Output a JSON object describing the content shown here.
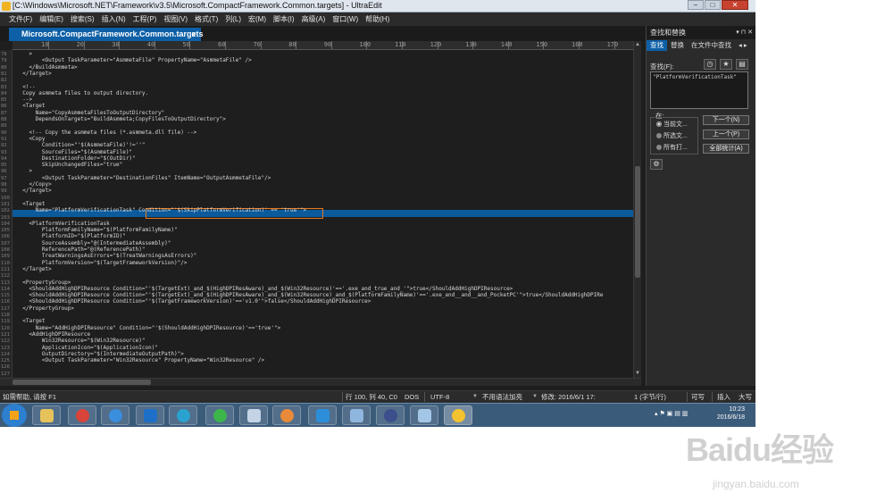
{
  "window": {
    "title": "[C:\\Windows\\Microsoft.NET\\Framework\\v3.5\\Microsoft.CompactFramework.Common.targets] - UltraEdit",
    "min": "–",
    "max": "□",
    "close": "✕"
  },
  "menu": [
    "文件(F)",
    "编辑(E)",
    "搜索(S)",
    "插入(N)",
    "工程(P)",
    "视图(V)",
    "格式(T)",
    "列(L)",
    "宏(M)",
    "脚本(I)",
    "高级(A)",
    "窗口(W)",
    "帮助(H)"
  ],
  "tab": {
    "label": "Microsoft.CompactFramework.Common.targets",
    "close": "x"
  },
  "ruler": [
    "10",
    "20",
    "30",
    "40",
    "50",
    "60",
    "70",
    "80",
    "90",
    "100",
    "110",
    "120",
    "130",
    "140",
    "150",
    "160",
    "170"
  ],
  "editor": {
    "line_numbers": [
      "78",
      "79",
      "80",
      "81",
      "82",
      "83",
      "84",
      "85",
      "86",
      "87",
      "88",
      "89",
      "90",
      "91",
      "92",
      "93",
      "94",
      "95",
      "96",
      "97",
      "98",
      "99",
      "100",
      "101",
      "102",
      "103",
      "104",
      "105",
      "106",
      "107",
      "108",
      "109",
      "110",
      "111",
      "112",
      "113",
      "114",
      "115",
      "116",
      "117",
      "118",
      "119",
      "120",
      "121",
      "122",
      "123",
      "124",
      "125",
      "126",
      "127"
    ],
    "code": [
      "    >",
      "        <Output TaskParameter=\"AsmmetaFile\" PropertyName=\"AsmmetaFile\" />",
      "    </BuildAsmmeta>",
      "  </Target>",
      "",
      "  <!--",
      "  Copy asmmeta files to output directory.",
      "  -->",
      "  <Target",
      "      Name=\"CopyAsmmetaFilesToOutputDirectory\"",
      "      DependsOnTargets=\"BuildAsmmeta;CopyFilesToOutputDirectory\">",
      "",
      "    <!-- Copy the asmmeta files (*.asmmeta.dll file) -->",
      "    <Copy",
      "        Condition=\"'$(AsmmetaFile)'!=''\"",
      "        SourceFiles=\"$(AsmmetaFile)\"",
      "        DestinationFolder=\"$(OutDir)\"",
      "        SkipUnchangedFiles=\"true\"",
      "    >",
      "        <Output TaskParameter=\"DestinationFiles\" ItemName=\"OutputAsmmetaFile\"/>",
      "    </Copy>",
      "  </Target>",
      "",
      "  <Target",
      "      Name=\"PlatformVerificationTask\" Condition=\"'$(SkipPlatformVerification)' == 'true'\">",
      "",
      "    <PlatformVerificationTask",
      "        PlatformFamilyName=\"$(PlatformFamilyName)\"",
      "        PlatformID=\"$(PlatformID)\"",
      "        SourceAssembly=\"@(IntermediateAssembly)\"",
      "        ReferencePath=\"@(ReferencePath)\"",
      "        TreatWarningsAsErrors=\"$(TreatWarningsAsErrors)\"",
      "        PlatformVersion=\"$(TargetFrameworkVersion)\"/>",
      "  </Target>",
      "",
      "  <PropertyGroup>",
      "    <ShouldAddHighDPIResource Condition=\"'$(TargetExt)_and_$(HighDPIResAware)_and_$(Win32Resource)'=='.exe_and_true_and_'\">true</ShouldAddHighDPIResource>",
      "    <ShouldAddHighDPIResource Condition=\"'$(TargetExt)_and_$(HighDPIResAware)_and_$(Win32Resource)_and_$(PlatformFamilyName)'=='.exe_and__and__and_PocketPC'\">true</ShouldAddHighDPIRe",
      "    <ShouldAddHighDPIResource Condition=\"'$(TargetFrameworkVersion)'=='v1.0'\">false</ShouldAddHighDPIResource>",
      "  </PropertyGroup>",
      "",
      "  <Target",
      "      Name=\"AddHighDPIResource\" Condition=\"'$(ShouldAddHighDPIResource)'=='true'\">",
      "    <AddHighDPIResource",
      "        Win32Resource=\"$(Win32Resource)\"",
      "        ApplicationIcon=\"$(ApplicationIcon)\"",
      "        OutputDirectory=\"$(IntermediateOutputPath)\">",
      "        <Output TaskParameter=\"Win32Resource\" PropertyName=\"Win32Resource\" />",
      "",
      ""
    ]
  },
  "panel": {
    "title": "查找和替换",
    "controls": "▾ ⊓ ✕",
    "tabs": [
      "查找",
      "替换",
      "在文件中查找"
    ],
    "tabs_more": "◂ ▸",
    "find_label": "查找(F):",
    "find_value": "\"PlatformVerificationTask\"",
    "in_label": "在:",
    "scopes": [
      "当前文...",
      "所选文...",
      "所有打..."
    ],
    "next_button": "下一个(N)",
    "prev_button": "上一个(P)",
    "count_button": "全部统计(A)"
  },
  "status": {
    "help": "如需帮助, 请按 F1",
    "position": "行 100, 列 40, C0",
    "line_ending": "DOS",
    "encoding": "UTF-8",
    "highlight": "不用语法加亮",
    "modified": "修改: 2016/6/1 17:",
    "size": "1 (字节/行)",
    "rw": "可写",
    "insert": "插入",
    "case": "大写"
  },
  "taskbar": {
    "time": "10:23",
    "date": "2016/6/18"
  },
  "watermark": {
    "brand": "Baidu经验",
    "url": "jingyan.baidu.com"
  },
  "colors": {
    "accent": "#0d5fa6",
    "highlight_line": "#0b5a9c",
    "selection_border": "#e8781c",
    "editor_bg": "#1e1e1e",
    "taskbar": "#3b5b7a"
  }
}
